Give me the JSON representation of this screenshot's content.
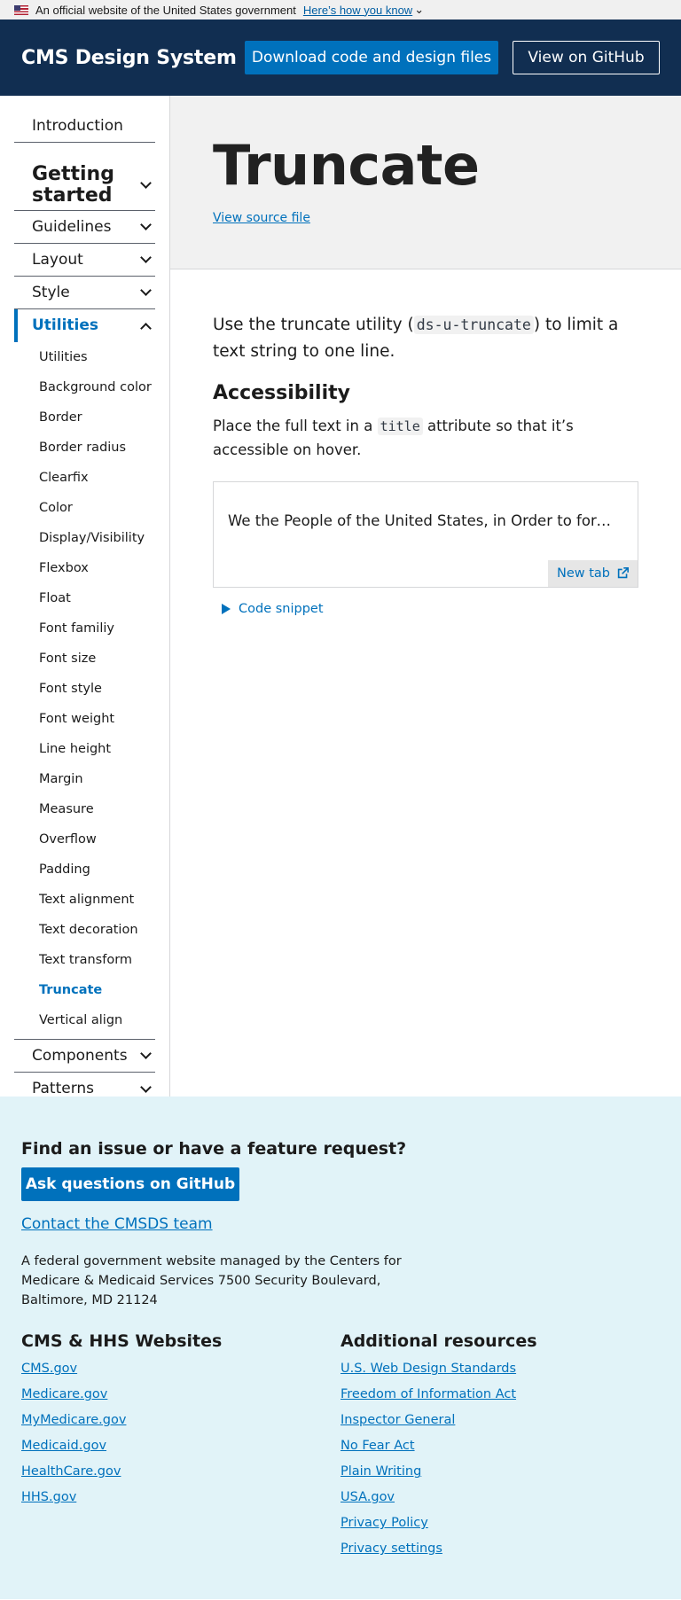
{
  "banner": {
    "text": "An official website of the United States government",
    "link": "Here’s how you know",
    "chevron": "⌄"
  },
  "header": {
    "title": "CMS Design System",
    "download_label": "Download code and design files",
    "github_label": "View on GitHub"
  },
  "sidebar": {
    "top_items": [
      {
        "label": "Introduction"
      },
      {
        "label": "Getting started"
      },
      {
        "label": "Guidelines"
      },
      {
        "label": "Layout"
      },
      {
        "label": "Style"
      },
      {
        "label": "Utilities"
      }
    ],
    "utility_items": [
      "Utilities",
      "Background color",
      "Border",
      "Border radius",
      "Clearfix",
      "Color",
      "Display/Visibility",
      "Flexbox",
      "Float",
      "Font familiy",
      "Font size",
      "Font style",
      "Font weight",
      "Line height",
      "Margin",
      "Measure",
      "Overflow",
      "Padding",
      "Text alignment",
      "Text decoration",
      "Text transform",
      "Truncate",
      "Vertical align"
    ],
    "bottom_items": [
      {
        "label": "Components"
      },
      {
        "label": "Patterns"
      }
    ]
  },
  "page": {
    "title": "Truncate",
    "source_link": "View source file",
    "intro_pre": "Use the truncate utility (",
    "intro_code": "ds-u-truncate",
    "intro_post": ") to limit a text string to one line.",
    "a11y_heading": "Accessibility",
    "a11y_pre": "Place the full text in a ",
    "a11y_code": "title",
    "a11y_post": " attribute so that it’s accessible on hover.",
    "example_text": "We the People of the United States, in Order to form a more perfect Union, establish Justice, insure domestic Tranquility, provide for the common defence, promote the general Welfare, and secure the Blessings of Liberty to ourselves and our Posterity, do ordain and establish this Constitution for the United States of America.",
    "new_tab": "New tab",
    "snippet": "Code snippet"
  },
  "footer": {
    "question": "Find an issue or have a feature request?",
    "ask_button": "Ask questions on GitHub",
    "contact": "Contact the CMSDS team",
    "fed_text": "A federal government website managed by the Centers for Medicare & Medicaid Services 7500 Security Boulevard, Baltimore, MD 21124",
    "col1_heading": "CMS & HHS Websites",
    "col1_links": [
      "CMS.gov",
      "Medicare.gov",
      "MyMedicare.gov",
      "Medicaid.gov",
      "HealthCare.gov",
      "HHS.gov"
    ],
    "col2_heading": "Additional resources",
    "col2_links": [
      "U.S. Web Design Standards",
      "Freedom of Information Act",
      "Inspector General",
      "No Fear Act",
      "Plain Writing",
      "USA.gov",
      "Privacy Policy",
      "Privacy settings"
    ]
  },
  "colors": {
    "header_bg": "#112e51",
    "primary": "#0071bc",
    "footer_bg": "#e1f3f8",
    "hero_bg": "#f1f1f1"
  },
  "icons": {
    "flag": "us-flag-icon",
    "external": "external-link-icon",
    "chevron": "chevron-down-icon",
    "triangle": "triangle-right-icon"
  }
}
